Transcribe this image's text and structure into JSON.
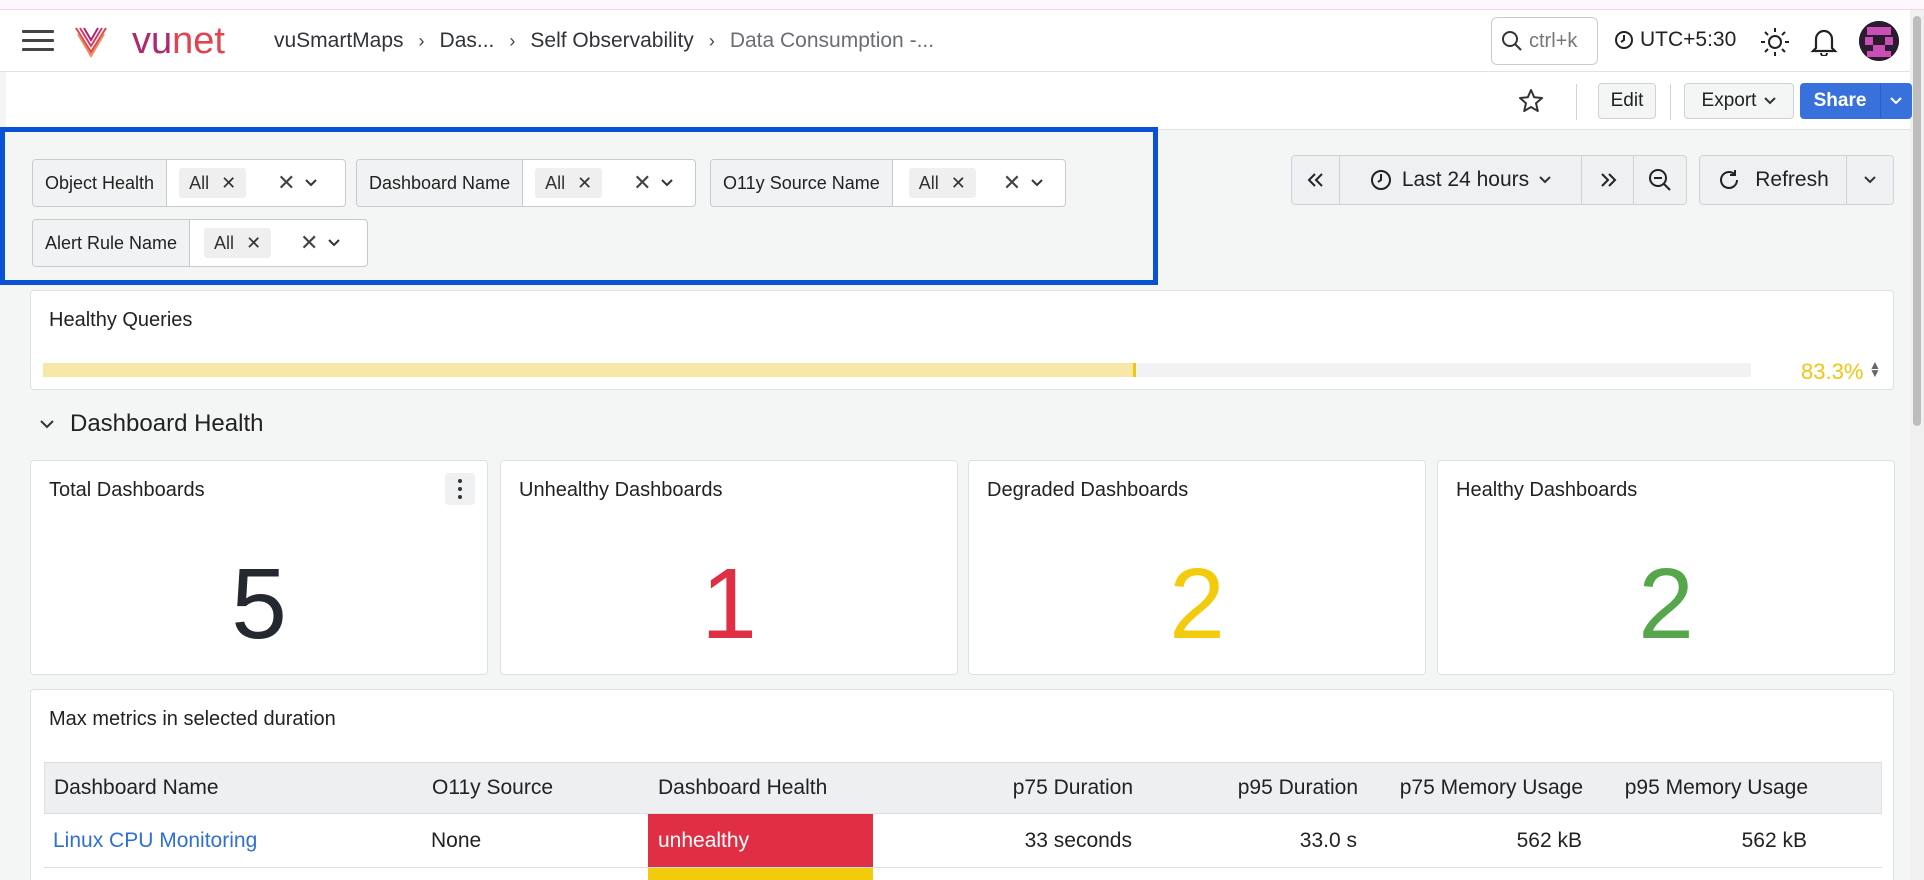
{
  "app": {
    "logo_text_a": "vu",
    "logo_text_b": "net"
  },
  "breadcrumb": {
    "items": [
      "vuSmartMaps",
      "Das...",
      "Self Observability"
    ],
    "current": "Data Consumption -..."
  },
  "topbar": {
    "search_placeholder": "ctrl+k",
    "timezone": "UTC+5:30"
  },
  "actions": {
    "edit": "Edit",
    "export": "Export",
    "share": "Share"
  },
  "filters": [
    {
      "label": "Object Health",
      "value": "All"
    },
    {
      "label": "Dashboard Name",
      "value": "All"
    },
    {
      "label": "O11y Source Name",
      "value": "All"
    },
    {
      "label": "Alert Rule Name",
      "value": "All"
    }
  ],
  "time": {
    "range": "Last 24 hours",
    "refresh": "Refresh"
  },
  "healthy_queries": {
    "title": "Healthy Queries",
    "percent_text": "83.3%",
    "fraction": 0.64
  },
  "section": {
    "title": "Dashboard Health"
  },
  "stats": [
    {
      "title": "Total Dashboards",
      "value": "5",
      "color": "#24292f"
    },
    {
      "title": "Unhealthy Dashboards",
      "value": "1",
      "color": "#e02f44"
    },
    {
      "title": "Degraded Dashboards",
      "value": "2",
      "color": "#f2cc0c"
    },
    {
      "title": "Healthy Dashboards",
      "value": "2",
      "color": "#56a64b"
    }
  ],
  "metrics": {
    "title": "Max metrics in selected duration",
    "columns": [
      "Dashboard Name",
      "O11y Source",
      "Dashboard Health",
      "p75 Duration",
      "p95 Duration",
      "p75 Memory Usage",
      "p95 Memory Usage"
    ],
    "rows": [
      {
        "name": "Linux CPU Monitoring",
        "source": "None",
        "health": "unhealthy",
        "p75_duration": "33 seconds",
        "p95_duration": "33.0 s",
        "p75_mem": "562 kB",
        "p95_mem": "562 kB",
        "health_color": "#e02f44"
      },
      {
        "name": "",
        "source": "",
        "health": "",
        "p75_duration": "",
        "p95_duration": "",
        "p75_mem": "",
        "p95_mem": "",
        "health_color": "#f2cc0c"
      }
    ]
  },
  "colors": {
    "accent": "#3871dc",
    "filter_highlight": "#0a52d4",
    "brand": "#b0266f"
  }
}
